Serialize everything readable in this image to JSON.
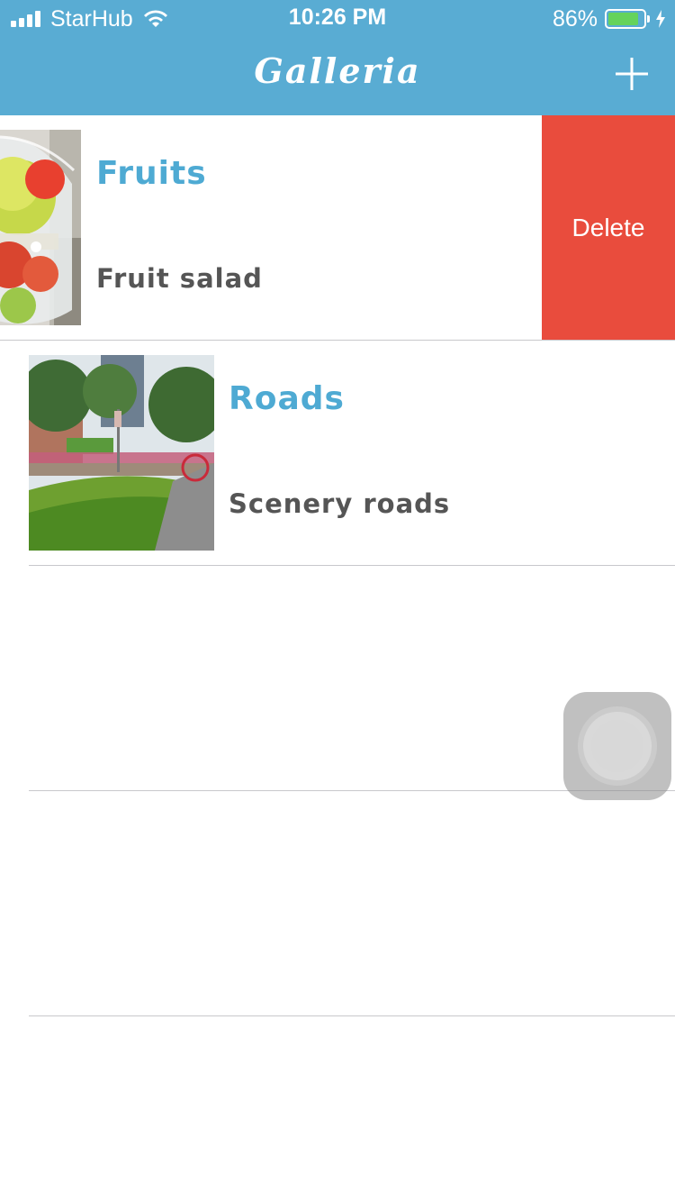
{
  "status_bar": {
    "carrier": "StarHub",
    "time": "10:26 PM",
    "battery_percent": "86%",
    "battery_level": 0.86,
    "icons": [
      "signal-icon",
      "wifi-icon",
      "battery-icon",
      "charging-bolt-icon"
    ]
  },
  "nav": {
    "title": "Galleria",
    "add_icon": "plus-icon"
  },
  "albums": [
    {
      "title": "Fruits",
      "subtitle": "Fruit salad",
      "swiped": true
    },
    {
      "title": "Roads",
      "subtitle": "Scenery roads",
      "swiped": false
    }
  ],
  "swipe_action": {
    "label": "Delete",
    "color": "#e94c3d"
  },
  "colors": {
    "header": "#59acd3",
    "title_text": "#4eaad3",
    "subtitle_text": "#555555",
    "delete": "#e94c3d"
  }
}
